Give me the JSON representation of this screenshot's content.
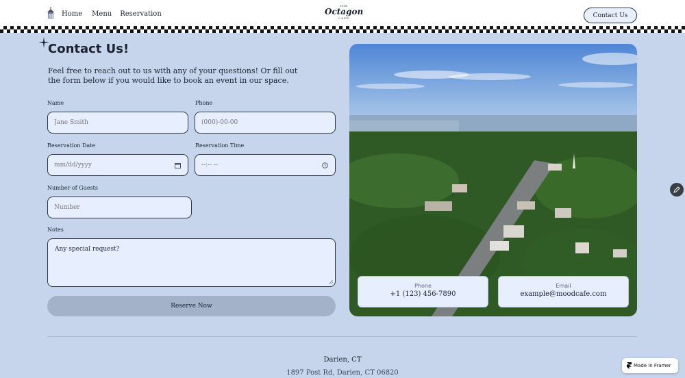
{
  "header": {
    "nav": [
      "Home",
      "Menu",
      "Reservation"
    ],
    "logo": {
      "top": "THE",
      "main": "Octagon",
      "bottom": "CAFE"
    },
    "cta": "Contact Us"
  },
  "contact": {
    "title": "Contact Us!",
    "intro": "Feel free to reach out to us with any of your questions! Or fill out the form below if you would like to book an event in our space.",
    "form": {
      "name_label": "Name",
      "name_placeholder": "Jane Smith",
      "phone_label": "Phone",
      "phone_placeholder": "(000)-00-00",
      "date_label": "Reservation Date",
      "date_placeholder": "mm/dd/yyyy",
      "time_label": "Reservation Time",
      "time_placeholder": "--:-- --",
      "guests_label": "Number of Guests",
      "guests_placeholder": "Number",
      "notes_label": "Notes",
      "notes_placeholder": "Any special request?",
      "submit": "Reserve Now"
    },
    "cards": {
      "phone_label": "Phone",
      "phone_value": "+1 (123) 456-7890",
      "email_label": "Email",
      "email_value": "example@moodcafe.com"
    }
  },
  "footer": {
    "city": "Darien, CT",
    "address": "1897 Post Rd, Darien, CT 06820"
  },
  "badge": "Made in Framer",
  "icons": [
    "home-icon",
    "sparkle-icon",
    "calendar-icon",
    "clock-icon",
    "resize-grip-icon",
    "edit-icon",
    "framer-icon"
  ],
  "colors": {
    "background": "#c6d5ec",
    "field": "#e7efff",
    "button": "#a3b2c9"
  }
}
